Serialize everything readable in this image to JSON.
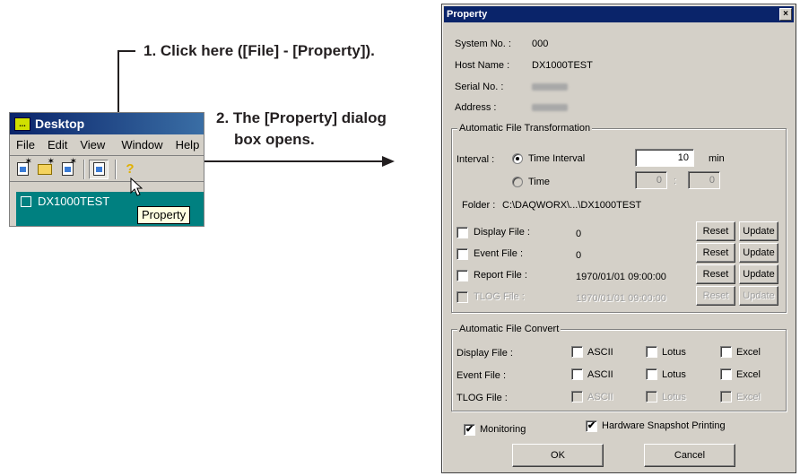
{
  "annotations": {
    "step1": "1. Click here ([File] - [Property]).",
    "step2_line1": "2. The [Property] dialog",
    "step2_line2": "box opens."
  },
  "desktop": {
    "title": "Desktop",
    "logo_text": "...",
    "menu": [
      "File",
      "Edit",
      "View",
      "Window",
      "Help"
    ],
    "window_title": "DX1000TEST",
    "tooltip": "Property",
    "toolbar_icons": [
      "new-chart-icon",
      "open-folder-icon",
      "new-window-icon",
      "property-icon",
      "help-icon"
    ]
  },
  "dialog": {
    "title": "Property",
    "close": "×",
    "system_no_label": "System No. :",
    "system_no_value": "000",
    "host_name_label": "Host Name :",
    "host_name_value": "DX1000TEST",
    "serial_label": "Serial No. :",
    "address_label": "Address :",
    "auto_transform": {
      "label": "Automatic File Transformation",
      "interval_label": "Interval :",
      "time_interval_label": "Time Interval",
      "time_interval_value": "10",
      "min_label": "min",
      "time_label": "Time",
      "time_hour": "0",
      "time_colon": ":",
      "time_minute": "0",
      "folder_label": "Folder :",
      "folder_value": "C:\\DAQWORX\\...\\DX1000TEST",
      "rows": [
        {
          "label": "Display File :",
          "value": "0",
          "reset": "Reset",
          "update": "Update"
        },
        {
          "label": "Event File :",
          "value": "0",
          "reset": "Reset",
          "update": "Update"
        },
        {
          "label": "Report File :",
          "value": "1970/01/01 09:00:00",
          "reset": "Reset",
          "update": "Update"
        },
        {
          "label": "TLOG File :",
          "value": "1970/01/01 09:00:00",
          "reset": "Reset",
          "update": "Update"
        }
      ]
    },
    "auto_convert": {
      "label": "Automatic File Convert",
      "rows": [
        {
          "label": "Display File :",
          "ascii": "ASCII",
          "lotus": "Lotus",
          "excel": "Excel"
        },
        {
          "label": "Event File :",
          "ascii": "ASCII",
          "lotus": "Lotus",
          "excel": "Excel"
        },
        {
          "label": "TLOG File :",
          "ascii": "ASCII",
          "lotus": "Lotus",
          "excel": "Excel"
        }
      ]
    },
    "monitoring_label": "Monitoring",
    "snapshot_label": "Hardware Snapshot Printing",
    "check_mark": "✔",
    "ok_label": "OK",
    "cancel_label": "Cancel"
  }
}
